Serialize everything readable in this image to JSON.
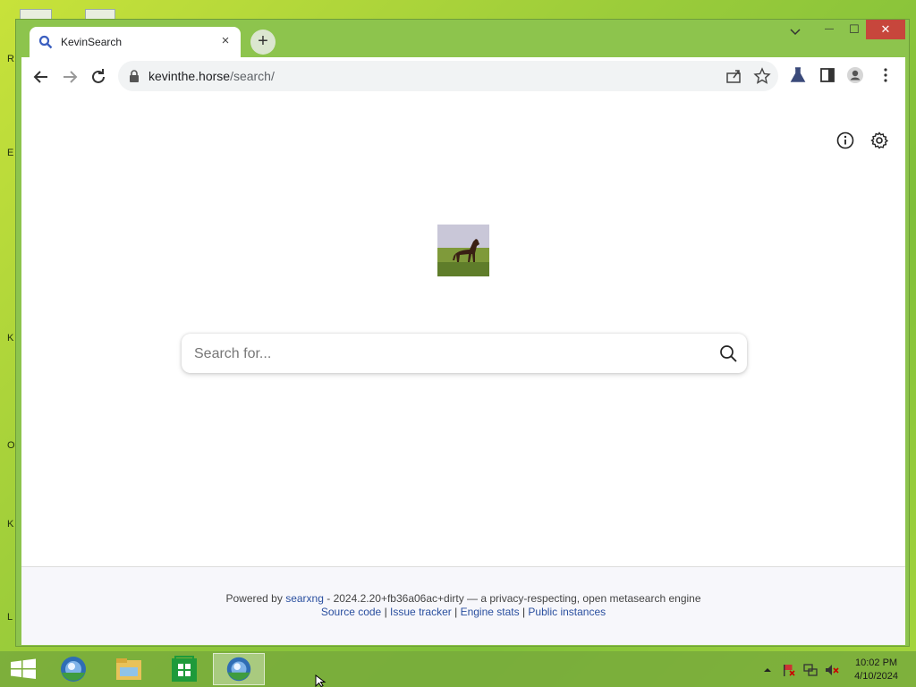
{
  "browser": {
    "tab_title": "KevinSearch",
    "tab_close": "×",
    "new_tab": "+",
    "window_controls": {
      "minimize": "—",
      "maximize": "☐",
      "close": "✕",
      "tab_search": "⌄"
    },
    "url_host": "kevinthe.horse",
    "url_path": "/search/"
  },
  "page": {
    "logo_icon": "horse-photo",
    "search_placeholder": "Search for...",
    "footer": {
      "powered_by": "Powered by",
      "engine_link": "searxng",
      "version_text": "- 2024.2.20+fb36a06ac+dirty — a privacy-respecting, open metasearch engine",
      "links": [
        "Source code",
        "Issue tracker",
        "Engine stats",
        "Public instances"
      ],
      "separator": "|"
    }
  },
  "taskbar": {
    "time": "10:02 PM",
    "date": "4/10/2024"
  },
  "colors": {
    "accent": "#8dc44d",
    "close": "#c7463c",
    "link": "#2a4f9f"
  }
}
